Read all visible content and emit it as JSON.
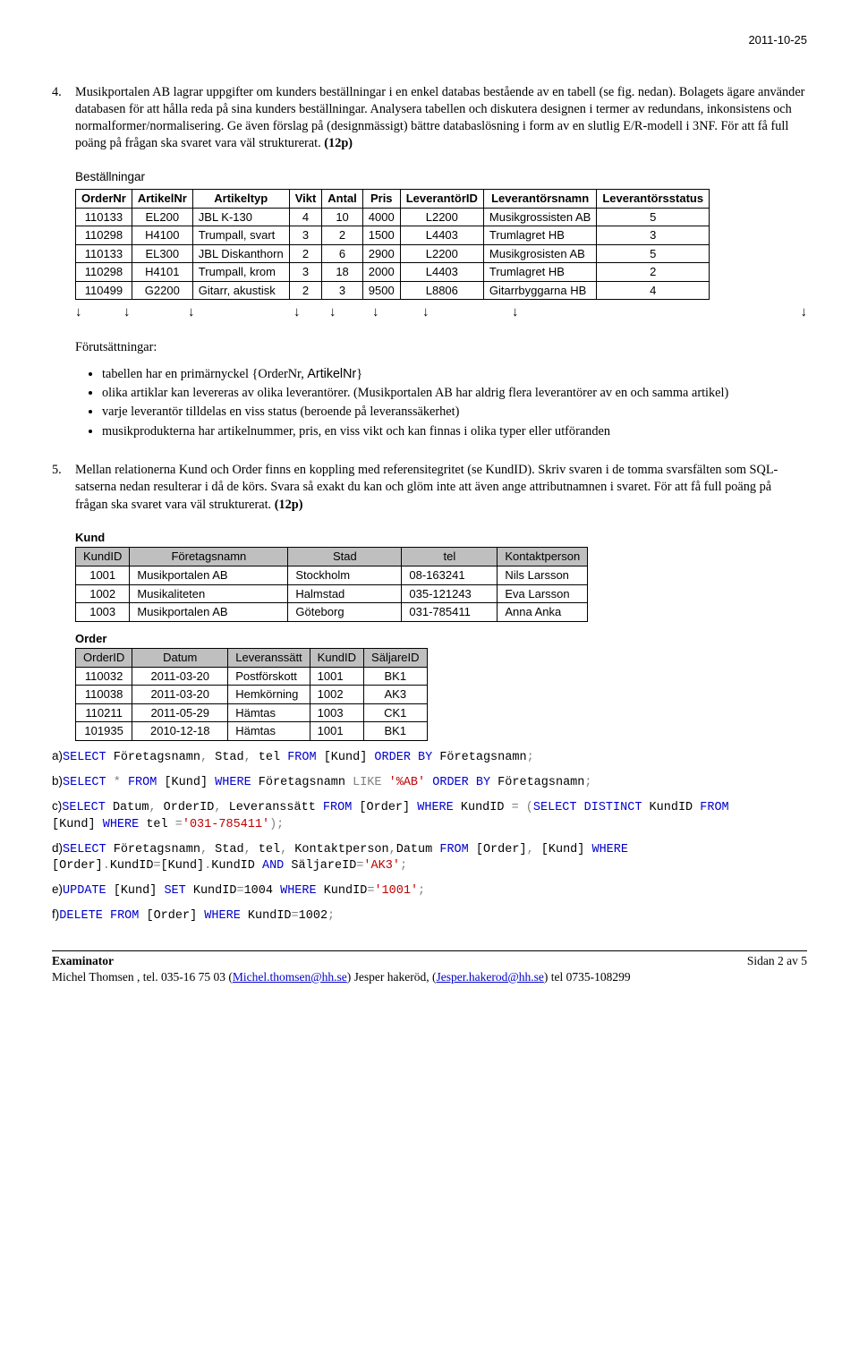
{
  "header": {
    "date": "2011-10-25"
  },
  "q4": {
    "num": "4.",
    "text": "Musikportalen AB lagrar uppgifter om kunders beställningar i en enkel databas bestående av en tabell (se fig. nedan). Bolagets ägare använder databasen för att hålla reda på sina kunders beställningar. Analysera tabellen och diskutera designen i termer av redundans, inkonsistens och normalformer/normalisering. Ge även förslag på (designmässigt) bättre databaslösning i form av en slutlig E/R-modell i 3NF. För att få full poäng på frågan ska svaret vara väl strukturerat. ",
    "points": "(12p)",
    "tabletitle": "Beställningar",
    "headers": [
      "OrderNr",
      "ArtikelNr",
      "Artikeltyp",
      "Vikt",
      "Antal",
      "Pris",
      "LeverantörID",
      "Leverantörsnamn",
      "Leverantörsstatus"
    ],
    "rows": [
      [
        "110133",
        "EL200",
        "JBL K-130",
        "4",
        "10",
        "4000",
        "L2200",
        "Musikgrossisten AB",
        "5"
      ],
      [
        "110298",
        "H4100",
        "Trumpall, svart",
        "3",
        "2",
        "1500",
        "L4403",
        "Trumlagret HB",
        "3"
      ],
      [
        "110133",
        "EL300",
        "JBL Diskanthorn",
        "2",
        "6",
        "2900",
        "L2200",
        "Musikgrosisten AB",
        "5"
      ],
      [
        "110298",
        "H4101",
        "Trumpall, krom",
        "3",
        "18",
        "2000",
        "L4403",
        "Trumlagret HB",
        "2"
      ],
      [
        "110499",
        "G2200",
        "Gitarr, akustisk",
        "2",
        "3",
        "9500",
        "L8806",
        "Gitarrbyggarna HB",
        "4"
      ]
    ],
    "forut_title": "Förutsättningar:",
    "bullets": [
      "tabellen har en primärnyckel {OrderNr, ArtikelNr}",
      "olika artiklar kan levereras av olika leverantörer. (Musikportalen AB har aldrig flera leverantörer av en och samma artikel)",
      "varje leverantör tilldelas en viss status (beroende på leveranssäkerhet)",
      "musikprodukterna har artikelnummer, pris, en viss vikt och kan finnas i olika typer eller utföranden"
    ]
  },
  "q5": {
    "num": "5.",
    "text": "Mellan relationerna Kund och Order finns en koppling med referensitegritet (se KundID). Skriv svaren i de tomma svarsfälten som SQL-satserna nedan resulterar i då de körs. Svara så exakt du kan och glöm inte att även ange attributnamnen i svaret. För att få full poäng på frågan ska svaret vara väl strukturerat. ",
    "points": "(12p)",
    "kund_title": "Kund",
    "kund_headers": [
      "KundID",
      "Företagsnamn",
      "Stad",
      "tel",
      "Kontaktperson"
    ],
    "kund_rows": [
      [
        "1001",
        "Musikportalen AB",
        "Stockholm",
        "08-163241",
        "Nils Larsson"
      ],
      [
        "1002",
        "Musikaliteten",
        "Halmstad",
        "035-121243",
        "Eva Larsson"
      ],
      [
        "1003",
        "Musikportalen AB",
        "Göteborg",
        "031-785411",
        "Anna Anka"
      ]
    ],
    "order_title": "Order",
    "order_headers": [
      "OrderID",
      "Datum",
      "Leveranssätt",
      "KundID",
      "SäljareID"
    ],
    "order_rows": [
      [
        "110032",
        "2011-03-20",
        "Postförskott",
        "1001",
        "BK1"
      ],
      [
        "110038",
        "2011-03-20",
        "Hemkörning",
        "1002",
        "AK3"
      ],
      [
        "110211",
        "2011-05-29",
        "Hämtas",
        "1003",
        "CK1"
      ],
      [
        "101935",
        "2010-12-18",
        "Hämtas",
        "1001",
        "BK1"
      ]
    ]
  },
  "sql": {
    "a_pre": "a)",
    "b_pre": "b)",
    "c_pre": "c)",
    "d_pre": "d)",
    "e_pre": "e)",
    "f_pre": "f)"
  },
  "footer": {
    "ex": "Examinator",
    "line": "Michel Thomsen , tel. 035-16 75 03 (",
    "mail1": "Michel.thomsen@hh.se",
    "mid": ") Jesper hakeröd, (",
    "mail2": "Jesper.hakerod@hh.se",
    "tail": ") tel 0735-108299",
    "page": "Sidan 2 av 5"
  }
}
